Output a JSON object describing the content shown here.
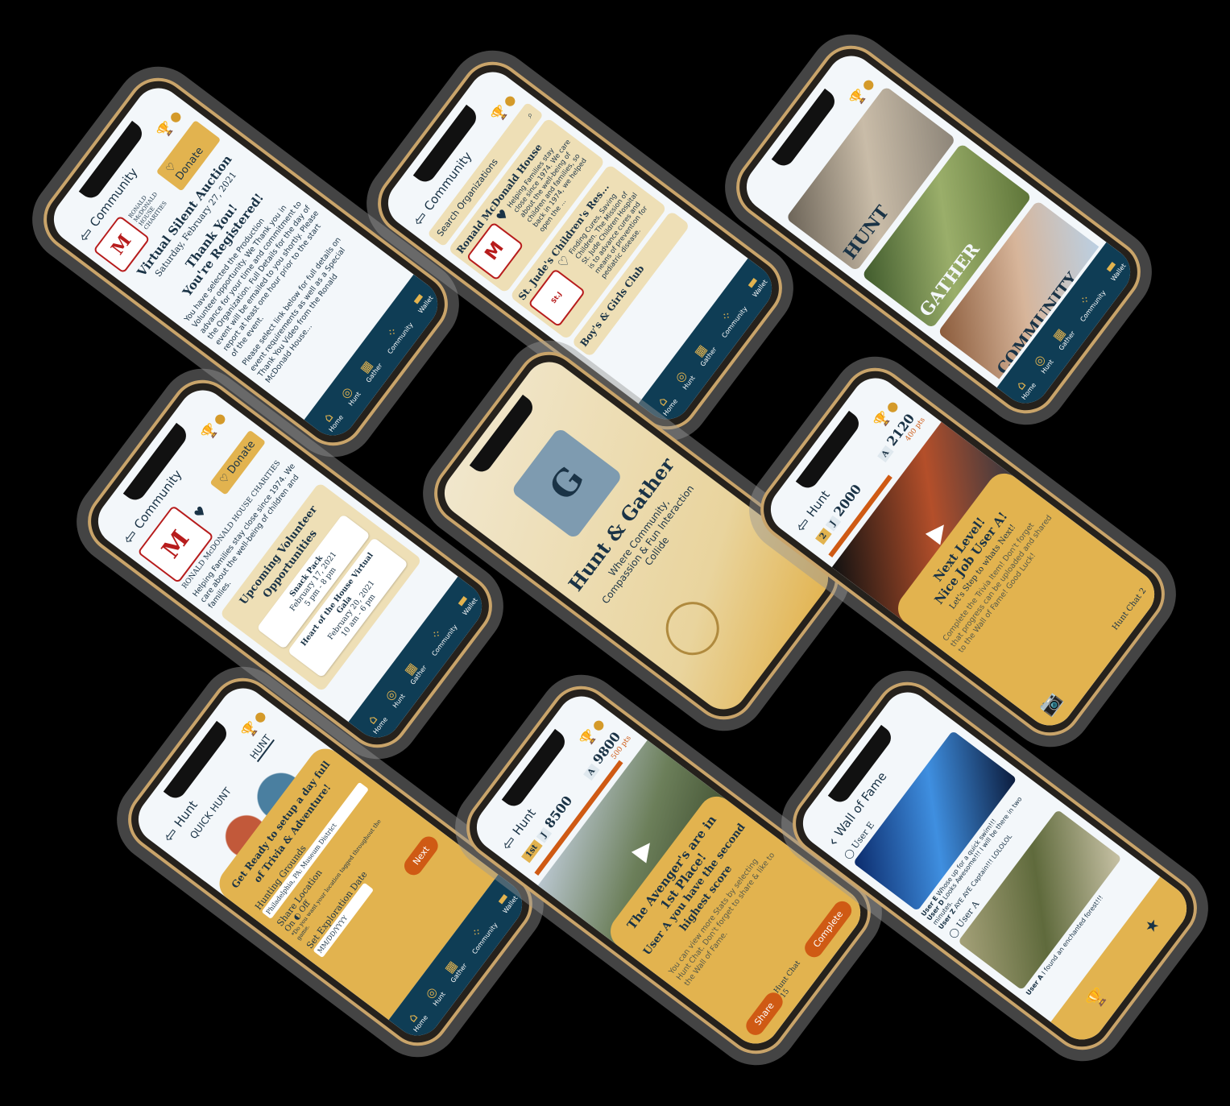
{
  "nav": {
    "home": "Home",
    "hunt": "Hunt",
    "gather": "Gather",
    "community": "Community",
    "wallet": "Wallet"
  },
  "colors": {
    "navy": "#0f3d55",
    "gold": "#e2b34f",
    "cream": "#eedfb6",
    "orange": "#cf5a14"
  },
  "phone_auction": {
    "header": "Community",
    "org_name": "RONALD McDONALD HOUSE CHARITIES",
    "donate": "Donate",
    "event_title": "Virtual Silent Auction",
    "event_date": "Saturday, February 27, 2021",
    "thank_you": "Thank You!",
    "registered": "You're Registered!",
    "body1": "You have selected the Production Volunteer opportunity. We Thank you in advance for your time and commitment to the Organization. Full Details for the day of event will be emailed to you shortly. Please report at least one hour prior to the start of the event.",
    "body2": "Please select link below for full details on event requirements as well as a Special Thank You Video from the Ronald McDonald House..."
  },
  "phone_search": {
    "header": "Community",
    "search_placeholder": "Search Organizations",
    "orgs": [
      {
        "name": "Ronald McDonald House",
        "logo": "RONALD McDONALD HOUSE CHARITIES",
        "desc": "Helping Families stay close since 1974. We care about the well-being of children and families, so back in 1974, we helped open the ..."
      },
      {
        "name": "St. Jude's Children's Res...",
        "logo": "St. Jude Children's Research Hospital",
        "desc": "Finding Cures, Saving Children. The Mission of St. Jude Children Hospital is to advance cures and means of prevention for pediatric disease."
      },
      {
        "name": "Boy's & Girls Club",
        "logo": "",
        "desc": ""
      }
    ]
  },
  "phone_home": {
    "words": [
      "HUNT",
      "GATHER",
      "COMMUNITY"
    ]
  },
  "phone_org": {
    "header": "Community",
    "org_name": "RONALD McDONALD HOUSE CHARITIES",
    "donate": "Donate",
    "tagline": "Helping Families stay close since 1974. We care about the well-being of children and families.",
    "section_title": "Upcoming Volunteer Opportunities",
    "events": [
      {
        "name": "Snack Pack",
        "date": "February 17, 2021",
        "time": "5 pm - 8 pm"
      },
      {
        "name": "Heart of the House Virtual Gala",
        "date": "February 20, 2021",
        "time": "10 am - 6 pm"
      }
    ]
  },
  "phone_splash": {
    "title": "Hunt & Gather",
    "subtitle": "Where Community, Compassion & Fun Interaction Collide"
  },
  "phone_level": {
    "header": "Hunt",
    "level": "2",
    "j_badge": "J",
    "j_score": "2000",
    "a_badge": "A",
    "a_score": "2120",
    "pts": "400 pts",
    "title1": "Next Level!",
    "title2": "Nice Job User A!",
    "sub": "Let's Step to whats Next!",
    "body": "Complete the Trivia Item! Don't forget that progress can be uploaded and shared to the Wall of Fame! Good Luck!",
    "chat": "Hunt Chat",
    "chat_count": "2"
  },
  "phone_quickhunt": {
    "header": "Hunt",
    "tab1": "QUICK HUNT",
    "tab2": "HUNT",
    "intro": "Get Ready to setup a day full of Trivia & Adventure!",
    "grounds_label": "Hunting Grounds",
    "grounds_value": "Philadelphia, PA: Museum District",
    "share_label": "Share Location",
    "share_on": "On",
    "share_off": "Off",
    "share_note": "*Do you want your location tagged throughout the game.",
    "date_label": "Set Exploration Date",
    "date_placeholder": "MM/DD/YYYY",
    "next": "Next"
  },
  "phone_first": {
    "header": "Hunt",
    "place": "1st",
    "j_badge": "J",
    "j_score": "8500",
    "a_badge": "A",
    "a_score": "9800",
    "pts": "500 pts",
    "title": "The Avenger's are in 1st Place!",
    "sub": "User A you have the second highest score",
    "body": "You can view more Stats by selecting Hunt Chat. Don't forget to share & like to the Wall of Fame.",
    "share": "Share",
    "complete": "Complete",
    "chat": "Hunt Chat",
    "chat_count": "15"
  },
  "phone_wall": {
    "header": "Wall of Fame",
    "post1_user": "User E",
    "comments": [
      {
        "user": "User E",
        "text": "Whose up for a quick swim!!!"
      },
      {
        "user": "User D",
        "text": "Looks Awesome!!! I will be there in two minutes."
      },
      {
        "user": "User Z",
        "text": "AYE AYE Captain!!! LOLOLOL"
      }
    ],
    "post2_user": "User A",
    "post2_comment_user": "User A",
    "post2_comment": "I found an enchanted forest!!!"
  }
}
